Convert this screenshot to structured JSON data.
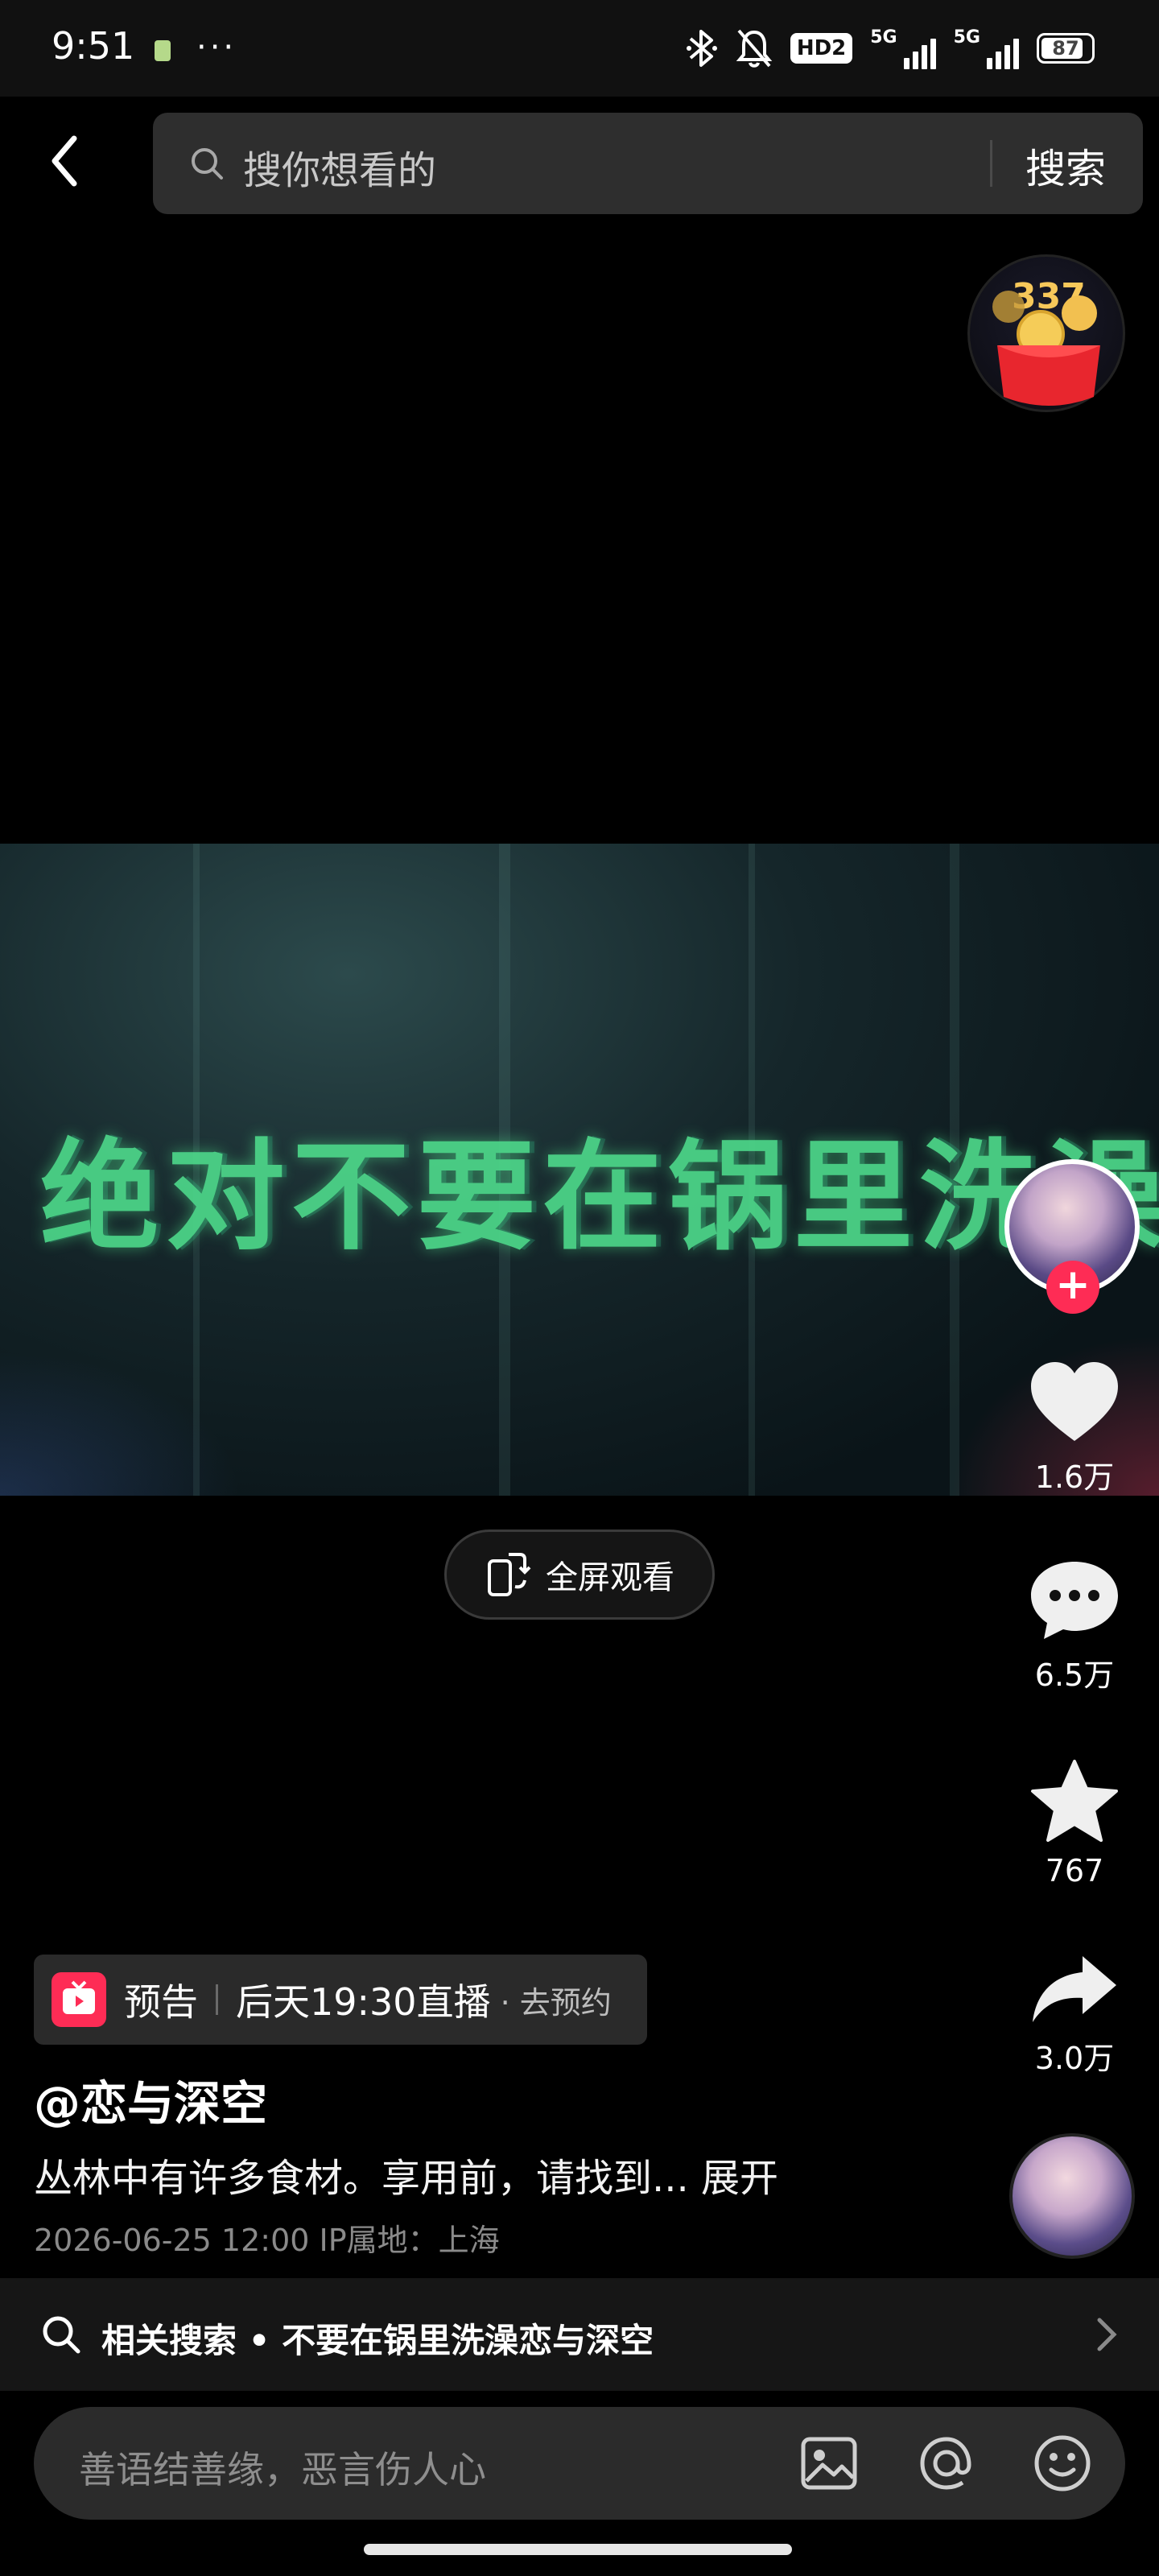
{
  "status_bar": {
    "time": "9:51",
    "dots": "···",
    "hd_label": "HD2",
    "net1": "5G",
    "net2": "5G",
    "battery": "87",
    "battery_level": 0.87
  },
  "search": {
    "placeholder": "搜你想看的",
    "button": "搜索"
  },
  "reward": {
    "count": "337"
  },
  "video": {
    "title_text": "绝对不要在锅里洗澡"
  },
  "fullscreen": {
    "label": "全屏观看"
  },
  "rail": {
    "likes": "1.6万",
    "comments": "6.5万",
    "favorites": "767",
    "shares": "3.0万"
  },
  "live_notice": {
    "tag": "预告",
    "time": "后天19:30直播",
    "action": "· 去预约"
  },
  "post": {
    "author": "@恋与深空",
    "caption": "丛林中有许多食材。享用前，请找到... 展开",
    "meta": "2026-06-25 12:00   IP属地：上海"
  },
  "related": {
    "label": "相关搜索 • 不要在锅里洗澡恋与深空"
  },
  "comment": {
    "placeholder": "善语结善缘，恶言伤人心"
  },
  "colors": {
    "accent": "#fe2c55",
    "background": "#000000",
    "title_green": "#4dd88a"
  }
}
